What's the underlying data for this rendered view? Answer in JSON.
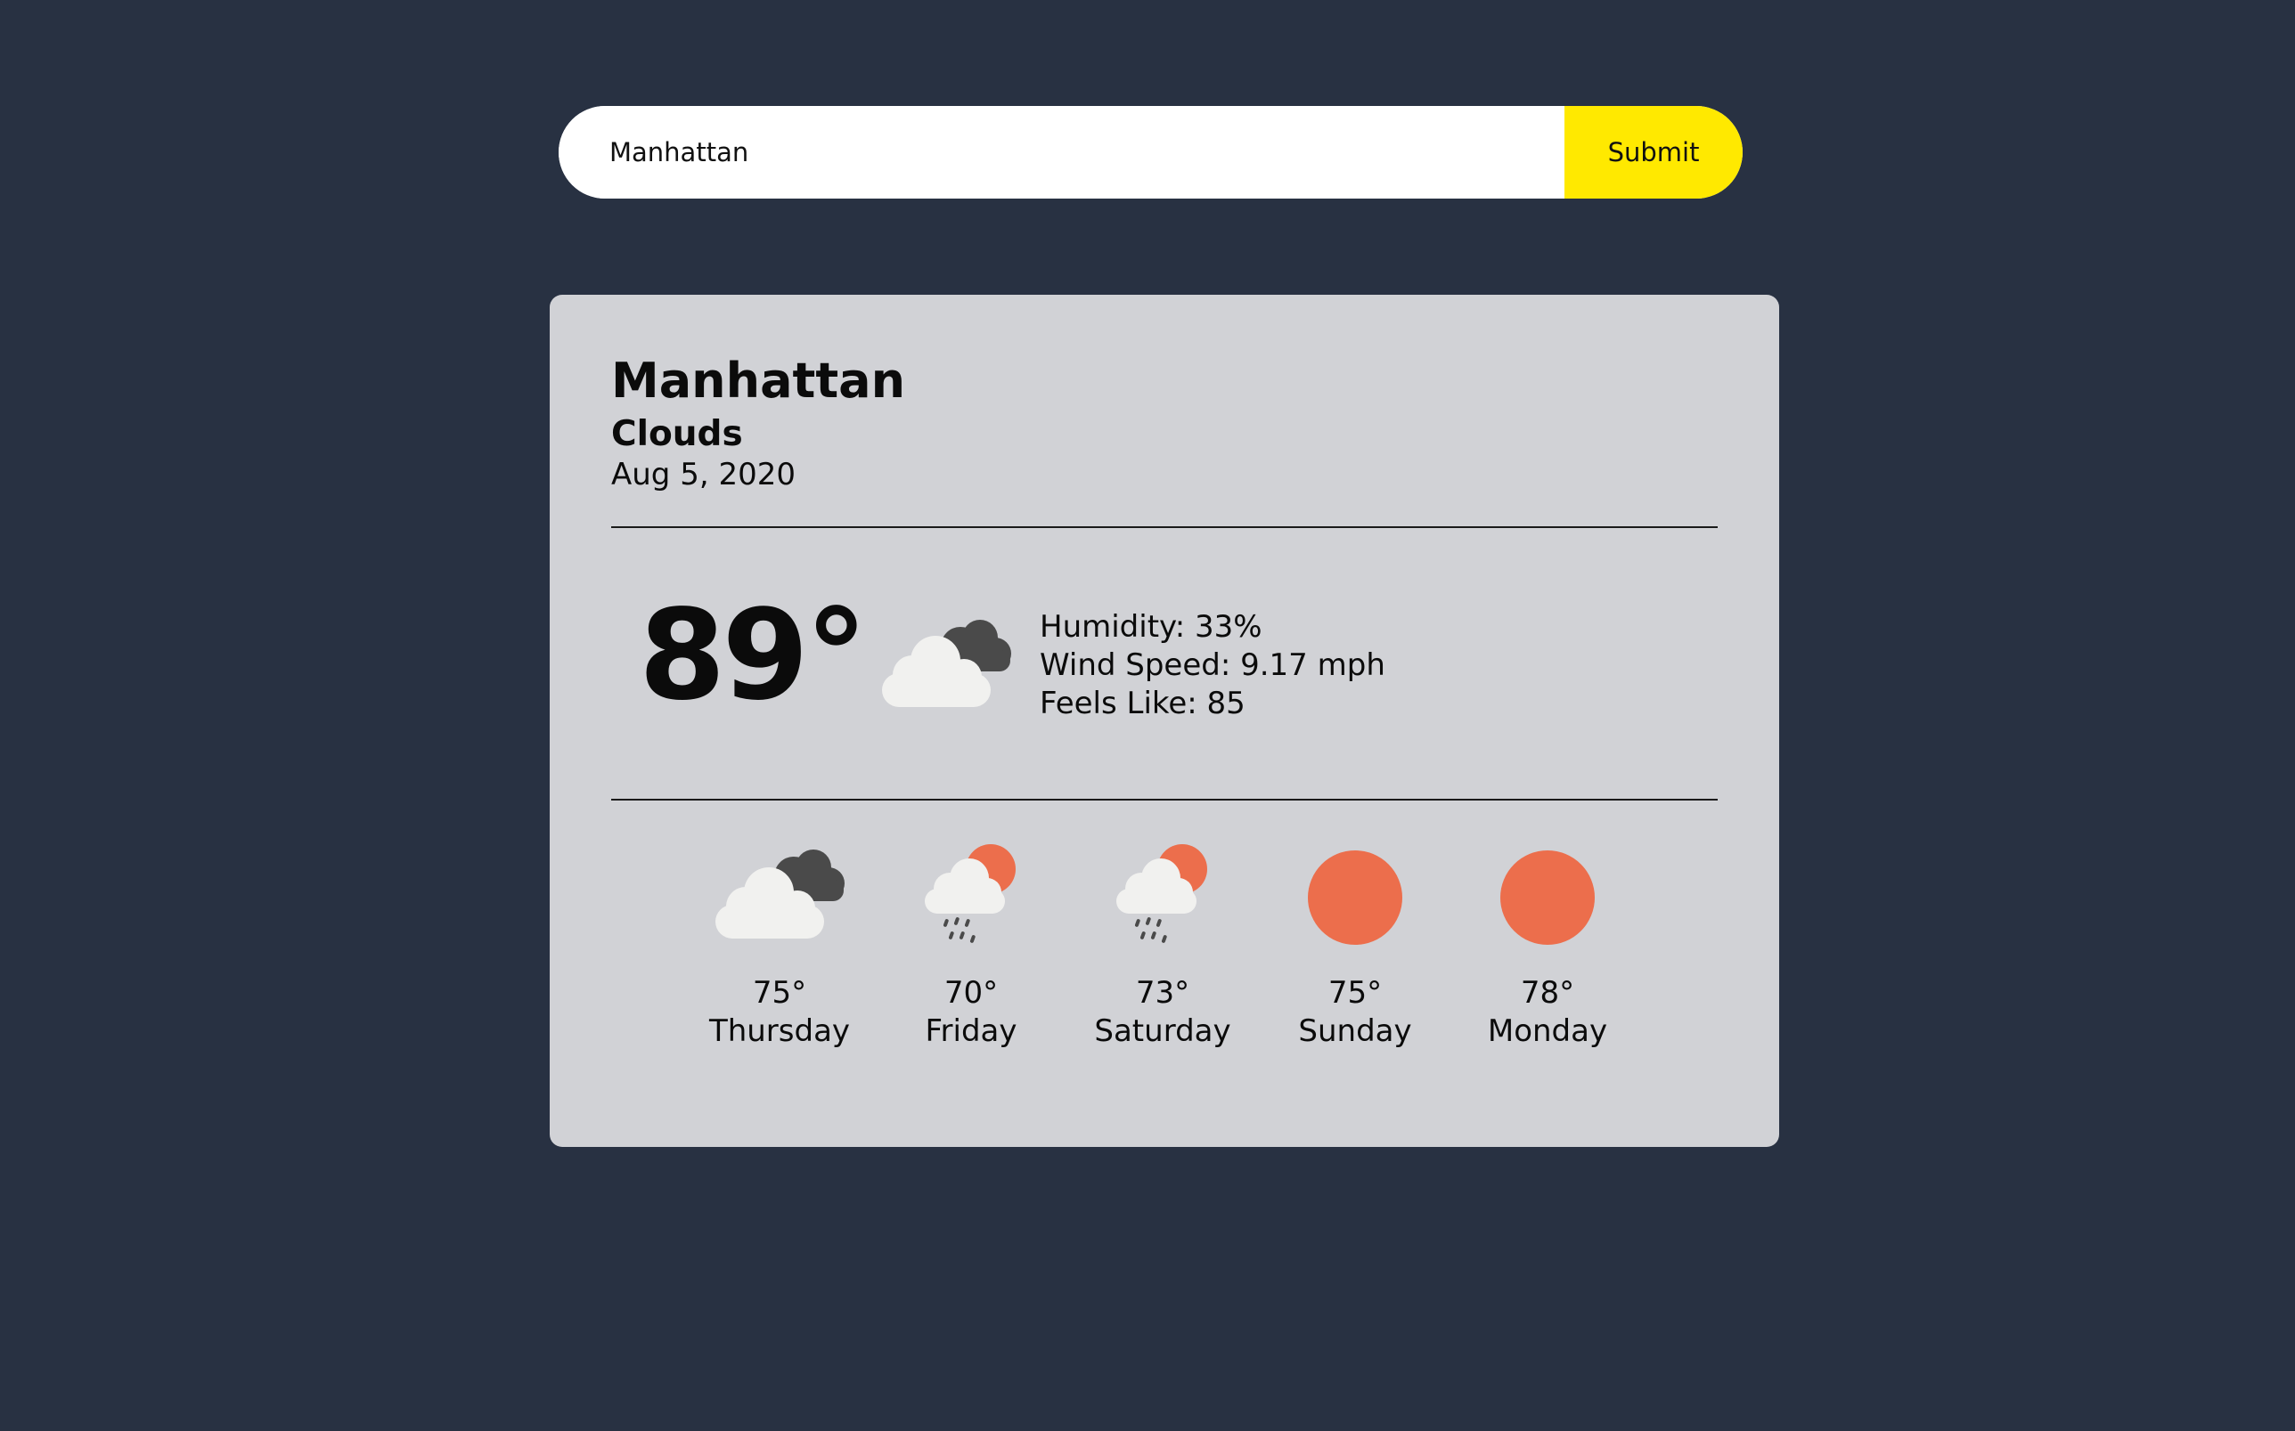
{
  "search": {
    "value": "Manhattan",
    "placeholder": "",
    "submit_label": "Submit"
  },
  "current": {
    "location": "Manhattan",
    "condition": "Clouds",
    "date": "Aug 5, 2020",
    "temperature": "89°",
    "icon": "clouds-icon",
    "humidity": "Humidity: 33%",
    "wind_speed": "Wind Speed: 9.17 mph",
    "feels_like": "Feels Like: 85"
  },
  "forecast": [
    {
      "day": "Thursday",
      "temp": "75°",
      "icon": "clouds-icon"
    },
    {
      "day": "Friday",
      "temp": "70°",
      "icon": "rain-sun-icon"
    },
    {
      "day": "Saturday",
      "temp": "73°",
      "icon": "rain-sun-icon"
    },
    {
      "day": "Sunday",
      "temp": "75°",
      "icon": "sun-icon"
    },
    {
      "day": "Monday",
      "temp": "78°",
      "icon": "sun-icon"
    }
  ],
  "colors": {
    "background": "#283142",
    "card": "#d1d2d6",
    "submit": "#ffe900",
    "sun": "#ec6e4c",
    "cloud_light": "#f1f1ef",
    "cloud_dark": "#4a4a4a"
  }
}
